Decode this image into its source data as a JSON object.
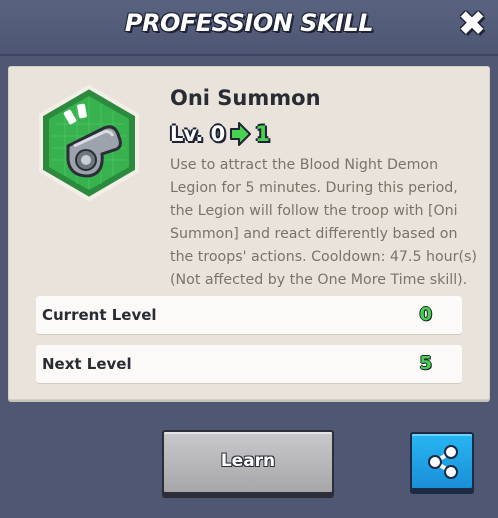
{
  "header": {
    "title": "PROFESSION SKILL"
  },
  "skill": {
    "name": "Oni Summon",
    "level_prefix": "Lv. 0",
    "level_next": "1",
    "description": "Use to attract the Blood Night Demon Legion for 5 minutes. During this period, the Legion will follow the troop with [Oni Summon] and react differently based on the troops' actions. Cooldown: 47.5 hour(s) (Not affected by the One More Time skill).",
    "icon": "whistle-icon"
  },
  "stats": {
    "current_label": "Current Level",
    "current_value": "0",
    "next_label": "Next Level",
    "next_value": "5"
  },
  "actions": {
    "learn_label": "Learn",
    "share_icon": "share-icon",
    "close_icon": "close-icon"
  },
  "colors": {
    "accent_green": "#47d14f",
    "share_blue": "#1a8fd8",
    "background": "#4f5772"
  }
}
